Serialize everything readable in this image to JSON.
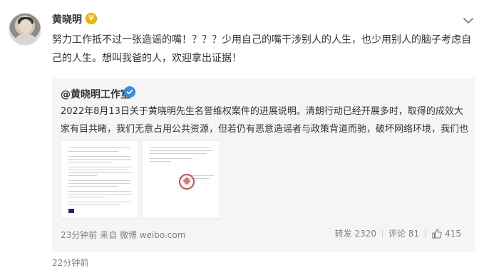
{
  "post": {
    "author": "黄晓明",
    "vip_badge": "V",
    "text": "努力工作抵不过一张造谣的嘴！？？？少用自己的嘴干涉别人的人生，也少用别人的脑子考虑自己的人生。想叫我爸的人，欢迎拿出证据！",
    "time": "22分钟前"
  },
  "repost": {
    "author": "@黄晓明工作室",
    "text": "2022年8月13日关于黄晓明先生名誉维权案件的进展说明。清朗行动已经开展多时，取得的成效大家有目共睹，我们无意占用公共资源，但若仍有恶意造谣者与政策背道而驰，破坏网络环境，我们也绝不姑息！",
    "meta": "23分钟前 来自 微博 weibo.com",
    "stats": {
      "reposts_label": "转发 2320",
      "comments_label": "评论 81",
      "likes": "415"
    }
  },
  "icons": {
    "more": "chevron-down-icon",
    "like": "thumb-up-icon",
    "verified": "verified-badge-icon"
  },
  "colors": {
    "text": "#333333",
    "muted": "#808080",
    "repost_bg": "#f5f5f5",
    "vip_gold": "#f7b500",
    "verified_blue": "#2f8eea"
  }
}
